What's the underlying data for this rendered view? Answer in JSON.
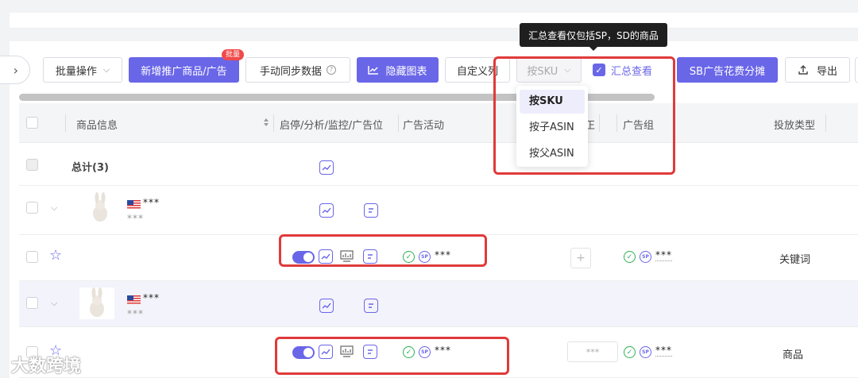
{
  "toolbar": {
    "bulk_ops": "批量操作",
    "add_promo": "新增推广商品/广告",
    "badge": "批量",
    "manual_sync": "手动同步数据",
    "hide_chart": "隐藏图表",
    "custom_col": "自定义列",
    "sku_select": "按SKU",
    "summary_view": "汇总查看",
    "sb_split": "SB广告花费分摊",
    "export": "导出"
  },
  "tooltip": "汇总查看仅包括SP，SD的商品",
  "dropdown": {
    "options": [
      "按SKU",
      "按子ASIN",
      "按父ASIN"
    ]
  },
  "table": {
    "headers": {
      "product": "商品信息",
      "status": "启停/分析/监控/广告位",
      "campaign": "广告活动",
      "group": "广告组",
      "type": "投放类型",
      "partial": "正"
    },
    "total_label": "总计(3)",
    "rows": [
      {
        "mask_title": "***",
        "mask_sub": "***"
      },
      {
        "campaign": "***",
        "group": "***",
        "type": "关键词"
      },
      {
        "mask_title": "***",
        "mask_sub": "***"
      },
      {
        "campaign": "***",
        "extra": "***",
        "group": "***",
        "type": "商品"
      }
    ]
  },
  "watermark": "大数跨境",
  "colors": {
    "accent": "#6a66e8",
    "highlight_red": "#e03a3a",
    "success": "#2db052"
  }
}
